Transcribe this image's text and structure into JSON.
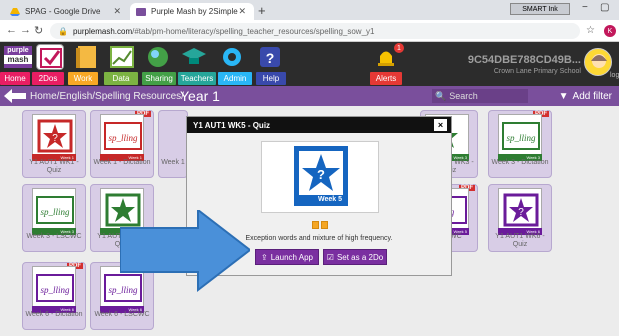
{
  "browser": {
    "tabs": [
      {
        "title": "SPAG - Google Drive",
        "icon": "google-drive-icon",
        "active": false
      },
      {
        "title": "Purple Mash by 2Simple",
        "icon": "purple-mash-icon",
        "active": true
      }
    ],
    "new_tab": "+",
    "smart_ink": "SMART Ink",
    "url_host": "purplemash.com",
    "url_path": "/#tab/pm-home/literacy/spelling_teacher_resources/spelling_sow_y1",
    "profile_initial": "K"
  },
  "app": {
    "logo_top": "purple",
    "logo_bottom": "mash",
    "menu": [
      "Home",
      "2Dos",
      "Work",
      "Data",
      "Sharing",
      "Teachers",
      "Admin",
      "Help",
      "Alerts"
    ],
    "alerts_count": "1",
    "user_id": "9C54DBE788CD49B...",
    "school": "Crown Lane Primary School",
    "logout": "logout"
  },
  "breadcrumb": {
    "path": "Home/English/Spelling Resources/",
    "current": "Year 1",
    "search_placeholder": "Search",
    "filter_label": "Add filter"
  },
  "cards": [
    {
      "label": "Y1 AUT1 WK1 - Quiz",
      "week": "Week 1",
      "pdf": false,
      "type": "quiz"
    },
    {
      "label": "Week 1 - Dictation",
      "week": "Week 1",
      "pdf": true,
      "type": "spelling"
    },
    {
      "label": "Week 1",
      "week": "Week 1",
      "pdf": false,
      "type": "spelling"
    },
    {
      "label": "Y1 AUT1 WK3 - Quiz",
      "week": "Week 3",
      "pdf": false,
      "type": "quiz"
    },
    {
      "label": "Week 3 - Dictation",
      "week": "Week 3",
      "pdf": true,
      "type": "spelling"
    },
    {
      "label": "Week 3 - LSCWC",
      "week": "Week 3",
      "pdf": false,
      "type": "spelling"
    },
    {
      "label": "Y1 AUT1 WK4 - Quiz",
      "week": "Week 4",
      "pdf": false,
      "type": "quiz"
    },
    {
      "label": "LSCWC",
      "week": "Week 5",
      "pdf": true,
      "type": "spelling"
    },
    {
      "label": "Y1 AUT1 WK6 - Quiz",
      "week": "Week 6",
      "pdf": false,
      "type": "quiz"
    },
    {
      "label": "Week 6 - Dictation",
      "week": "Week 6",
      "pdf": true,
      "type": "spelling"
    },
    {
      "label": "Week 6 - LSCWC",
      "week": "Week 6",
      "pdf": true,
      "type": "spelling"
    }
  ],
  "modal": {
    "title": "Y1 AUT1 WK5 - Quiz",
    "close": "×",
    "image_week": "Week 5",
    "description": "Exception words and mixture of high frequency.",
    "launch_label": "Launch App",
    "set2do_label": "Set as a 2Do"
  },
  "colors": {
    "purple": "#7a4f9c",
    "quiz_red": "#c62828",
    "quiz_blue": "#1565c0",
    "arrow_blue": "#4a90d9"
  }
}
